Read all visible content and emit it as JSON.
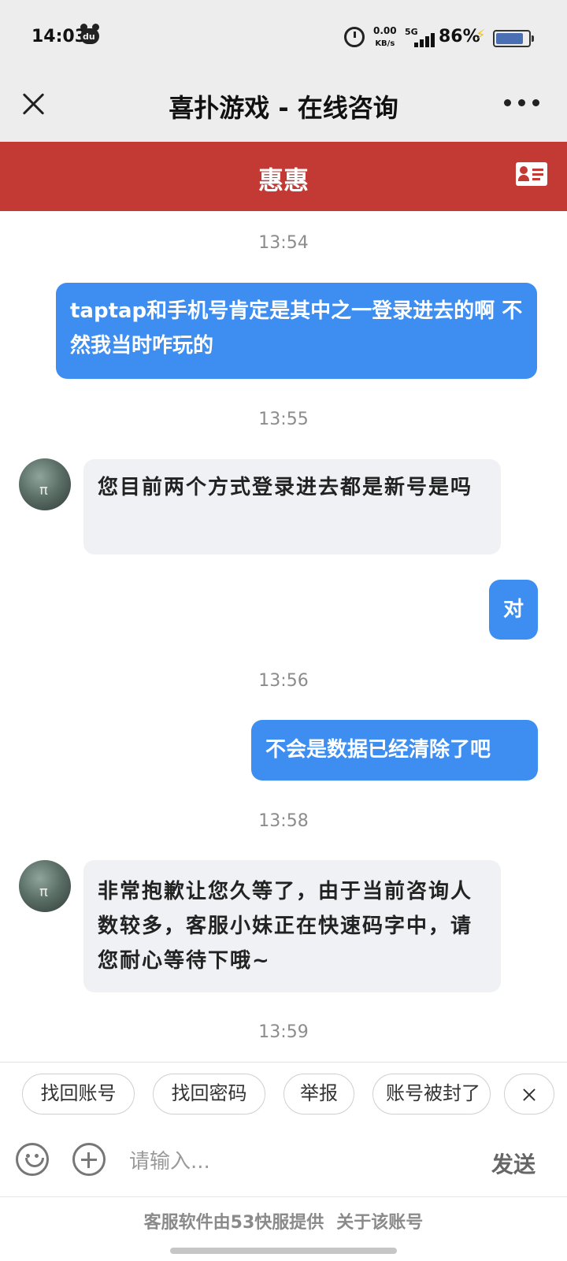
{
  "status_bar": {
    "time": "14:03",
    "app_icon": "du",
    "net_speed_value": "0.00",
    "net_speed_unit": "KB/s",
    "network_type": "5G",
    "battery_percent": "86%",
    "battery_level": 0.86
  },
  "title_bar": {
    "title": "喜扑游戏 - 在线咨询"
  },
  "agent_bar": {
    "agent_name": "惠惠"
  },
  "messages": [
    {
      "type": "time",
      "text": "13:54"
    },
    {
      "type": "sent",
      "text": "taptap和手机号肯定是其中之一登录进去的啊 不然我当时咋玩的"
    },
    {
      "type": "time",
      "text": "13:55"
    },
    {
      "type": "received",
      "text": "您目前两个方式登录进去都是新号是吗"
    },
    {
      "type": "sent",
      "text": "对"
    },
    {
      "type": "time",
      "text": "13:56"
    },
    {
      "type": "sent",
      "text": "不会是数据已经清除了吧"
    },
    {
      "type": "time",
      "text": "13:58"
    },
    {
      "type": "received",
      "text": "非常抱歉让您久等了，由于当前咨询人数较多，客服小妹正在快速码字中，请您耐心等待下哦~"
    },
    {
      "type": "time",
      "text": "13:59"
    }
  ],
  "quick_replies": [
    "找回账号",
    "找回密码",
    "举报",
    "账号被封了"
  ],
  "input_bar": {
    "placeholder": "请输入...",
    "send_label": "发送"
  },
  "footer": {
    "provider_text": "客服软件由53快服提供",
    "about_link": "关于该账号"
  },
  "colors": {
    "agent_bar_bg": "#c33a34",
    "sent_bubble": "#3d8ef0",
    "received_bubble": "#f0f1f4"
  }
}
